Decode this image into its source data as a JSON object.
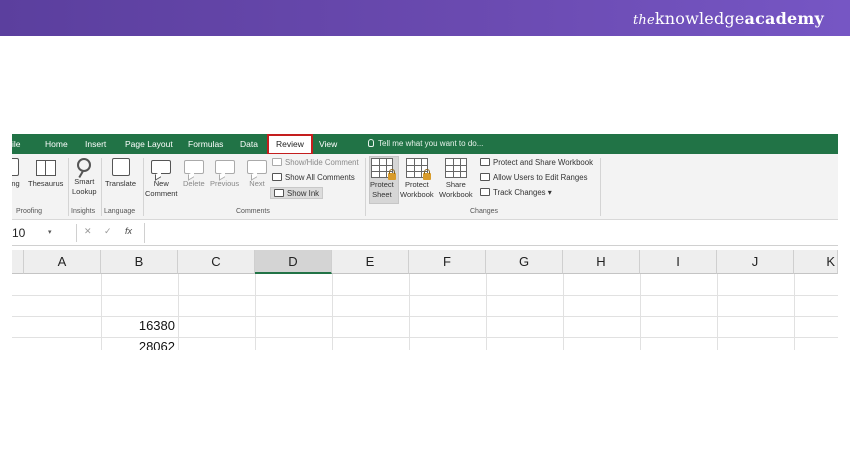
{
  "brand": {
    "prefix": "the",
    "middle": "knowledge",
    "suffix": "academy"
  },
  "tabs": [
    {
      "label": "ile",
      "left": 0
    },
    {
      "label": "Home"
    },
    {
      "label": "Insert"
    },
    {
      "label": "Page Layout"
    },
    {
      "label": "Formulas"
    },
    {
      "label": "Data"
    },
    {
      "label": "Review",
      "selected": true
    },
    {
      "label": "View"
    }
  ],
  "tell_me": "Tell me what you want to do...",
  "ribbon": {
    "proofing": {
      "spelling": "ling",
      "thesaurus": "Thesaurus",
      "label": "Proofing"
    },
    "insights": {
      "smart_lookup_1": "Smart",
      "smart_lookup_2": "Lookup",
      "label": "Insights"
    },
    "language": {
      "translate": "Translate",
      "label": "Language"
    },
    "comments": {
      "new_1": "New",
      "new_2": "Comment",
      "delete": "Delete",
      "previous": "Previous",
      "next": "Next",
      "show_hide": "Show/Hide Comment",
      "show_all": "Show All Comments",
      "show_ink": "Show Ink",
      "label": "Comments"
    },
    "changes": {
      "protect_sheet_1": "Protect",
      "protect_sheet_2": "Sheet",
      "protect_workbook_1": "Protect",
      "protect_workbook_2": "Workbook",
      "share_workbook_1": "Share",
      "share_workbook_2": "Workbook",
      "protect_share": "Protect and Share Workbook",
      "allow_users": "Allow Users to Edit Ranges",
      "track_changes": "Track Changes",
      "label": "Changes"
    }
  },
  "formula_bar": {
    "name_box": "10",
    "cancel": "✕",
    "enter": "✓",
    "fx": "fx",
    "value": ""
  },
  "columns": [
    "A",
    "B",
    "C",
    "D",
    "E",
    "F",
    "G",
    "H",
    "I",
    "J",
    "K"
  ],
  "selected_column": "D",
  "cells": {
    "B3": "16380",
    "B4": "28062"
  },
  "colors": {
    "banner": "#5b3f9e",
    "ribbon_tabs": "#217346",
    "review_highlight": "#c41e1e"
  }
}
